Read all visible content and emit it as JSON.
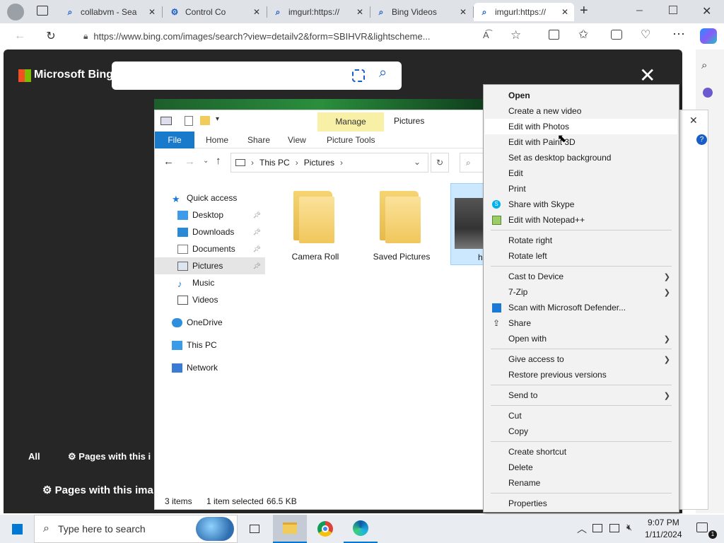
{
  "browser": {
    "tabs": [
      {
        "label": "collabvm - Sea",
        "icon": "search-icon"
      },
      {
        "label": "Control Co",
        "icon": "control-panel-icon"
      },
      {
        "label": "imgurl:https://",
        "icon": "search-icon"
      },
      {
        "label": "Bing Videos",
        "icon": "search-icon"
      },
      {
        "label": "imgurl:https://",
        "icon": "search-icon",
        "active": true
      }
    ],
    "url": "https://www.bing.com/images/search?view=detailv2&form=SBIHVR&lightscheme..."
  },
  "bing": {
    "logo": "Microsoft Bing",
    "bottom_tab_all": "All",
    "bottom_tab_pages": "Pages with this i",
    "bottom_heading": "Pages with this ima"
  },
  "explorer": {
    "ribbon_context": "Manage",
    "window_title": "Pictures",
    "tabs": [
      "File",
      "Home",
      "Share",
      "View",
      "Picture Tools"
    ],
    "path": [
      "This PC",
      "Pictures"
    ],
    "nav": [
      {
        "label": "Quick access",
        "type": "quick"
      },
      {
        "label": "Desktop",
        "pinned": true
      },
      {
        "label": "Downloads",
        "pinned": true
      },
      {
        "label": "Documents",
        "pinned": true
      },
      {
        "label": "Pictures",
        "pinned": true,
        "selected": true
      },
      {
        "label": "Music"
      },
      {
        "label": "Videos"
      },
      {
        "label": "OneDrive"
      },
      {
        "label": "This PC"
      },
      {
        "label": "Network"
      }
    ],
    "items": [
      {
        "label": "Camera Roll"
      },
      {
        "label": "Saved Pictures"
      },
      {
        "label": "h"
      }
    ],
    "status": {
      "count": "3 items",
      "selection": "1 item selected",
      "size": "66.5 KB"
    }
  },
  "context_menu": {
    "items": [
      {
        "label": "Open",
        "bold": true
      },
      {
        "label": "Create a new video"
      },
      {
        "label": "Edit with Photos",
        "highlight": true
      },
      {
        "label": "Edit with Paint 3D"
      },
      {
        "label": "Set as desktop background"
      },
      {
        "label": "Edit"
      },
      {
        "label": "Print"
      },
      {
        "label": "Share with Skype",
        "icon": "skype-icon"
      },
      {
        "label": "Edit with Notepad++",
        "icon": "notepadpp-icon"
      },
      {
        "sep": true
      },
      {
        "label": "Rotate right"
      },
      {
        "label": "Rotate left"
      },
      {
        "sep": true
      },
      {
        "label": "Cast to Device",
        "submenu": true
      },
      {
        "label": "7-Zip",
        "submenu": true
      },
      {
        "label": "Scan with Microsoft Defender...",
        "icon": "defender-icon"
      },
      {
        "label": "Share",
        "icon": "share-icon"
      },
      {
        "label": "Open with",
        "submenu": true
      },
      {
        "sep": true
      },
      {
        "label": "Give access to",
        "submenu": true
      },
      {
        "label": "Restore previous versions"
      },
      {
        "sep": true
      },
      {
        "label": "Send to",
        "submenu": true
      },
      {
        "sep": true
      },
      {
        "label": "Cut"
      },
      {
        "label": "Copy"
      },
      {
        "sep": true
      },
      {
        "label": "Create shortcut"
      },
      {
        "label": "Delete"
      },
      {
        "label": "Rename"
      },
      {
        "sep": true
      },
      {
        "label": "Properties"
      }
    ]
  },
  "taskbar": {
    "search_placeholder": "Type here to search",
    "time": "9:07 PM",
    "date": "1/11/2024"
  }
}
